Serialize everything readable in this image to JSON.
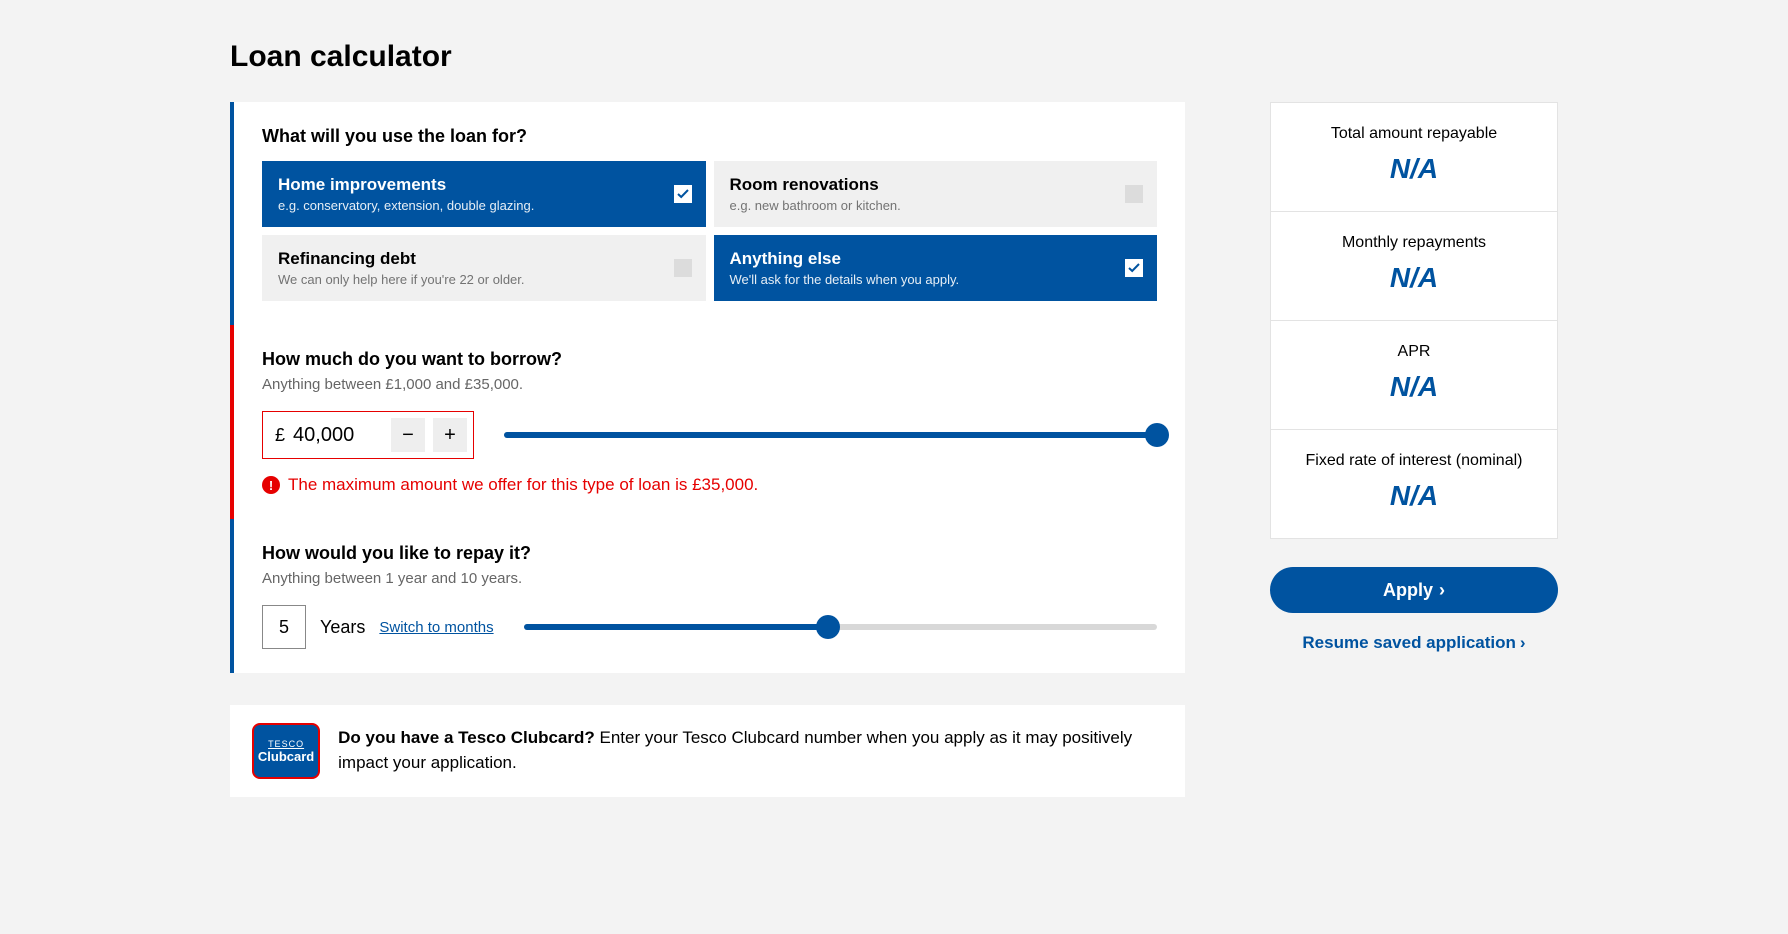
{
  "title": "Loan calculator",
  "purpose": {
    "heading": "What will you use the loan for?",
    "options": [
      {
        "title": "Home improvements",
        "sub": "e.g. conservatory, extension, double glazing.",
        "selected": true
      },
      {
        "title": "Room renovations",
        "sub": "e.g. new bathroom or kitchen.",
        "selected": false
      },
      {
        "title": "Refinancing debt",
        "sub": "We can only help here if you're 22 or older.",
        "selected": false
      },
      {
        "title": "Anything else",
        "sub": "We'll ask for the details when you apply.",
        "selected": true
      }
    ]
  },
  "amount": {
    "heading": "How much do you want to borrow?",
    "sub": "Anything between £1,000 and £35,000.",
    "currency": "£",
    "value": "40,000",
    "slider_pct": 100,
    "error": "The maximum amount we offer for this type of loan is £35,000."
  },
  "term": {
    "heading": "How would you like to repay it?",
    "sub": "Anything between 1 year and 10 years.",
    "value": "5",
    "unit": "Years",
    "switch_label": "Switch to months",
    "slider_pct": 48
  },
  "clubcard": {
    "badge_line1": "TESCO",
    "badge_line2": "Clubcard",
    "bold": "Do you have a Tesco Clubcard?",
    "rest": " Enter your Tesco Clubcard number when you apply as it may positively impact your application."
  },
  "summary": {
    "rows": [
      {
        "label": "Total amount repayable",
        "value": "N/A"
      },
      {
        "label": "Monthly repayments",
        "value": "N/A"
      },
      {
        "label": "APR",
        "value": "N/A"
      },
      {
        "label": "Fixed rate of interest (nominal)",
        "value": "N/A"
      }
    ]
  },
  "actions": {
    "apply": "Apply",
    "resume": "Resume saved application"
  }
}
